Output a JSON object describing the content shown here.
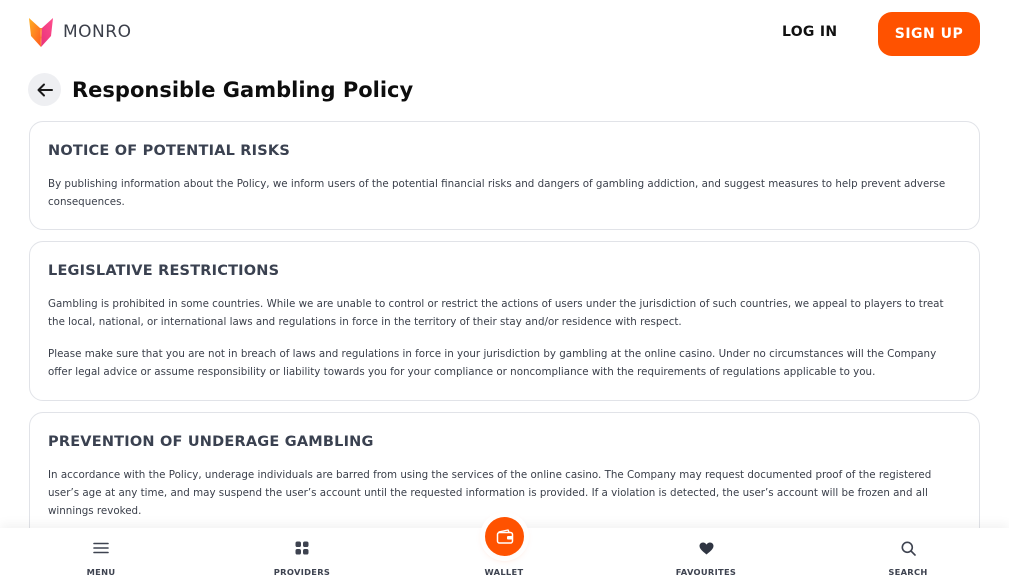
{
  "header": {
    "logo_text": "MONRO",
    "login_label": "LOG IN",
    "signup_label": "SIGN UP",
    "accent_color": "#ff5200"
  },
  "page": {
    "title": "Responsible Gambling Policy"
  },
  "sections": [
    {
      "heading": "NOTICE OF POTENTIAL RISKS",
      "paragraphs": [
        "By publishing information about the Policy, we inform users of the potential financial risks and dangers of gambling addiction, and suggest measures to help prevent adverse consequences."
      ]
    },
    {
      "heading": "LEGISLATIVE RESTRICTIONS",
      "paragraphs": [
        "Gambling is prohibited in some countries. While we are unable to control or restrict the actions of users under the jurisdiction of such countries, we appeal to players to treat the local, national, or international laws and regulations in force in the territory of their stay and/or residence with respect.",
        "Please make sure that you are not in breach of laws and regulations in force in your jurisdiction by gambling at the online casino. Under no circumstances will the Company offer legal advice or assume responsibility or liability towards you for your compliance or noncompliance with the requirements of regulations applicable to you."
      ]
    },
    {
      "heading": "PREVENTION OF UNDERAGE GAMBLING",
      "paragraphs": [
        "In accordance with the Policy, underage individuals are barred from using the services of the online casino. The Company may request documented proof of the registered user’s age at any time, and may suspend the user’s account until the requested information is provided. If a violation is detected, the user’s account will be frozen and all winnings revoked."
      ]
    }
  ],
  "bottom_nav": {
    "items": [
      {
        "label": "MENU",
        "icon": "hamburger-menu-icon"
      },
      {
        "label": "PROVIDERS",
        "icon": "grid-icon"
      },
      {
        "label": "WALLET",
        "icon": "wallet-icon"
      },
      {
        "label": "FAVOURITES",
        "icon": "heart-icon"
      },
      {
        "label": "SEARCH",
        "icon": "search-icon"
      }
    ]
  }
}
